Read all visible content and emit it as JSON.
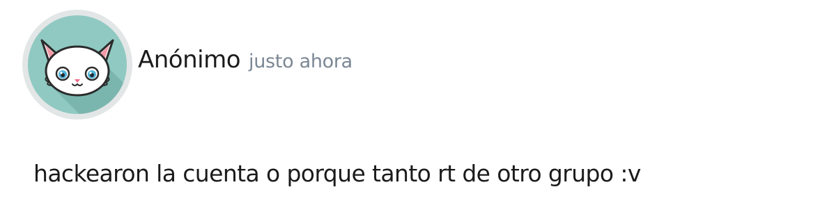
{
  "post": {
    "author": "Anónimo",
    "timestamp": "justo ahora",
    "text": "hackearon la cuenta o porque tanto rt de otro grupo :v",
    "avatar_icon": "white-cat-face-icon"
  },
  "colors": {
    "avatar_ring": "#e3e6e6",
    "avatar_background": "#8fc9c2",
    "avatar_shadow": "#7ab6ae",
    "author_text": "#1b1b1b",
    "timestamp_text": "#7b8794",
    "body_text": "#1b1b1b"
  }
}
